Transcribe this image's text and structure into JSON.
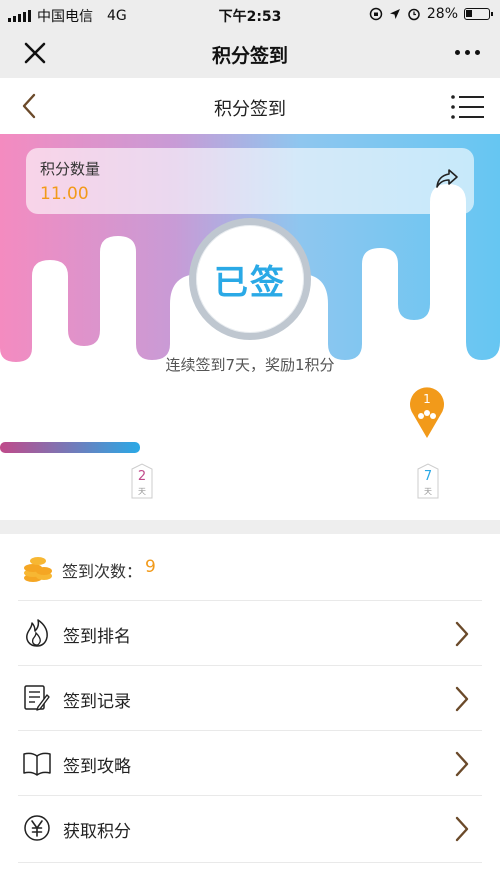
{
  "status_bar": {
    "carrier": "中国电信",
    "network": "4G",
    "time": "下午2:53",
    "battery": "28%",
    "battery_level": 0.28
  },
  "wechat_bar": {
    "title": "积分签到",
    "close_icon": "close-icon",
    "more_icon": "more-icon"
  },
  "header": {
    "title": "积分签到",
    "back_icon": "back-icon",
    "menu_icon": "menu-icon"
  },
  "points": {
    "label": "积分数量",
    "value": "11.00",
    "share_icon": "share-icon"
  },
  "sign": {
    "button_label": "已签",
    "reward_text": "连续签到7天，奖励1积分"
  },
  "progress": {
    "current_day": 1,
    "marker_label": "1",
    "milestones": [
      {
        "day": "2",
        "unit": "天",
        "color": "#c04a8a"
      },
      {
        "day": "7",
        "unit": "天",
        "color": "#2aa9e6"
      }
    ],
    "fill_fraction": 0.28
  },
  "sign_count": {
    "label": "签到次数：",
    "value": "9"
  },
  "menu": [
    {
      "label": "签到排名",
      "icon": "flame-icon"
    },
    {
      "label": "签到记录",
      "icon": "record-icon"
    },
    {
      "label": "签到攻略",
      "icon": "book-icon"
    },
    {
      "label": "获取积分",
      "icon": "yen-icon"
    }
  ],
  "colors": {
    "accent_orange": "#f29a1a",
    "accent_blue": "#2aa9e6",
    "gradient_pink": "#f48bc0",
    "gradient_blue": "#66c6f2",
    "arrow_brown": "#6b4a2a"
  }
}
